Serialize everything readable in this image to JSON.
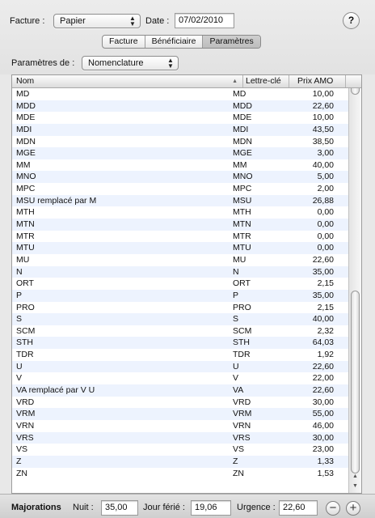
{
  "header": {
    "facture_label": "Facture :",
    "facture_value": "Papier",
    "date_label": "Date :",
    "date_value": "07/02/2010",
    "help_label": "?"
  },
  "tabs": [
    {
      "label": "Facture",
      "selected": false
    },
    {
      "label": "Bénéficiaire",
      "selected": false
    },
    {
      "label": "Paramètres",
      "selected": true
    }
  ],
  "parametres": {
    "label": "Paramètres de :",
    "value": "Nomenclature"
  },
  "table": {
    "columns": {
      "nom": "Nom",
      "lettre": "Lettre-clé",
      "prix": "Prix AMO"
    },
    "sort_indicator": "▲",
    "rows": [
      {
        "nom": "MD",
        "lettre": "MD",
        "prix": "10,00"
      },
      {
        "nom": "MDD",
        "lettre": "MDD",
        "prix": "22,60"
      },
      {
        "nom": "MDE",
        "lettre": "MDE",
        "prix": "10,00"
      },
      {
        "nom": "MDI",
        "lettre": "MDI",
        "prix": "43,50"
      },
      {
        "nom": "MDN",
        "lettre": "MDN",
        "prix": "38,50"
      },
      {
        "nom": "MGE",
        "lettre": "MGE",
        "prix": "3,00"
      },
      {
        "nom": "MM",
        "lettre": "MM",
        "prix": "40,00"
      },
      {
        "nom": "MNO",
        "lettre": "MNO",
        "prix": "5,00"
      },
      {
        "nom": "MPC",
        "lettre": "MPC",
        "prix": "2,00"
      },
      {
        "nom": "MSU remplacé par M",
        "lettre": "MSU",
        "prix": "26,88"
      },
      {
        "nom": "MTH",
        "lettre": "MTH",
        "prix": "0,00"
      },
      {
        "nom": "MTN",
        "lettre": "MTN",
        "prix": "0,00"
      },
      {
        "nom": "MTR",
        "lettre": "MTR",
        "prix": "0,00"
      },
      {
        "nom": "MTU",
        "lettre": "MTU",
        "prix": "0,00"
      },
      {
        "nom": "MU",
        "lettre": "MU",
        "prix": "22,60"
      },
      {
        "nom": "N",
        "lettre": "N",
        "prix": "35,00"
      },
      {
        "nom": "ORT",
        "lettre": "ORT",
        "prix": "2,15"
      },
      {
        "nom": "P",
        "lettre": "P",
        "prix": "35,00"
      },
      {
        "nom": "PRO",
        "lettre": "PRO",
        "prix": "2,15"
      },
      {
        "nom": "S",
        "lettre": "S",
        "prix": "40,00"
      },
      {
        "nom": "SCM",
        "lettre": "SCM",
        "prix": "2,32"
      },
      {
        "nom": "STH",
        "lettre": "STH",
        "prix": "64,03"
      },
      {
        "nom": "TDR",
        "lettre": "TDR",
        "prix": "1,92"
      },
      {
        "nom": "U",
        "lettre": "U",
        "prix": "22,60"
      },
      {
        "nom": "V",
        "lettre": "V",
        "prix": "22,00"
      },
      {
        "nom": "VA remplacé par V U",
        "lettre": "VA",
        "prix": "22,60"
      },
      {
        "nom": "VRD",
        "lettre": "VRD",
        "prix": "30,00"
      },
      {
        "nom": "VRM",
        "lettre": "VRM",
        "prix": "55,00"
      },
      {
        "nom": "VRN",
        "lettre": "VRN",
        "prix": "46,00"
      },
      {
        "nom": "VRS",
        "lettre": "VRS",
        "prix": "30,00"
      },
      {
        "nom": "VS",
        "lettre": "VS",
        "prix": "23,00"
      },
      {
        "nom": "Z",
        "lettre": "Z",
        "prix": "1,33"
      },
      {
        "nom": "ZN",
        "lettre": "ZN",
        "prix": "1,53"
      }
    ]
  },
  "majorations": {
    "title": "Majorations",
    "nuit_label": "Nuit :",
    "nuit_value": "35,00",
    "jour_ferie_label": "Jour férié :",
    "jour_ferie_value": "19,06",
    "urgence_label": "Urgence :",
    "urgence_value": "22,60",
    "remove_label": "−",
    "add_label": "+"
  }
}
